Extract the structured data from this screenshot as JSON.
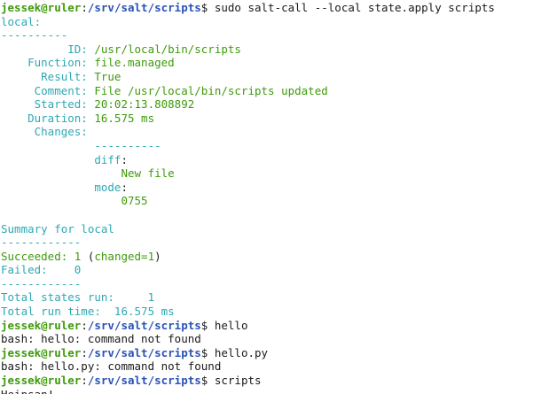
{
  "colors": {
    "background": "#ffffff",
    "text": "#1a1a1a",
    "prompt_user": "#3f9a0c",
    "prompt_path": "#2a52b8",
    "salt_cyan": "#2ea8b4",
    "salt_green": "#3f9a0c"
  },
  "lines": [
    {
      "segs": [
        [
          "user",
          "jessek@ruler"
        ],
        [
          "pl",
          ":"
        ],
        [
          "path",
          "/srv/salt/scripts"
        ],
        [
          "pl",
          "$ "
        ],
        [
          "cmd",
          "sudo salt-call --local state.apply scripts"
        ]
      ],
      "name": "prompt-line",
      "interactable": false
    },
    {
      "segs": [
        [
          "cy",
          "local:"
        ]
      ],
      "name": "minion-header"
    },
    {
      "segs": [
        [
          "cy",
          "----------"
        ]
      ],
      "name": "separator"
    },
    {
      "segs": [
        [
          "cy",
          "          ID: "
        ],
        [
          "gr",
          "/usr/local/bin/scripts"
        ]
      ],
      "name": "state-id"
    },
    {
      "segs": [
        [
          "cy",
          "    Function: "
        ],
        [
          "gr",
          "file.managed"
        ]
      ],
      "name": "state-function"
    },
    {
      "segs": [
        [
          "cy",
          "      Result: "
        ],
        [
          "gr",
          "True"
        ]
      ],
      "name": "state-result"
    },
    {
      "segs": [
        [
          "cy",
          "     Comment: "
        ],
        [
          "gr",
          "File /usr/local/bin/scripts updated"
        ]
      ],
      "name": "state-comment"
    },
    {
      "segs": [
        [
          "cy",
          "     Started: "
        ],
        [
          "gr",
          "20:02:13.808892"
        ]
      ],
      "name": "state-started"
    },
    {
      "segs": [
        [
          "cy",
          "    Duration: "
        ],
        [
          "gr",
          "16.575 ms"
        ]
      ],
      "name": "state-duration"
    },
    {
      "segs": [
        [
          "cy",
          "     Changes:"
        ]
      ],
      "name": "state-changes"
    },
    {
      "segs": [
        [
          "cy",
          "              ----------"
        ]
      ],
      "name": "changes-separator"
    },
    {
      "segs": [
        [
          "cy",
          "              diff"
        ],
        [
          "pl",
          ":"
        ]
      ],
      "name": "changes-diff-key"
    },
    {
      "segs": [
        [
          "gr",
          "                  New file"
        ]
      ],
      "name": "changes-diff-value"
    },
    {
      "segs": [
        [
          "cy",
          "              mode"
        ],
        [
          "pl",
          ":"
        ]
      ],
      "name": "changes-mode-key"
    },
    {
      "segs": [
        [
          "gr",
          "                  0755"
        ]
      ],
      "name": "changes-mode-value"
    },
    {
      "segs": [],
      "name": "blank-line"
    },
    {
      "segs": [
        [
          "cy",
          "Summary for local"
        ]
      ],
      "name": "summary-header"
    },
    {
      "segs": [
        [
          "cy",
          "------------"
        ]
      ],
      "name": "summary-separator"
    },
    {
      "segs": [
        [
          "gr",
          "Succeeded: 1 "
        ],
        [
          "pl",
          "("
        ],
        [
          "gr",
          "changed=1"
        ],
        [
          "pl",
          ")"
        ]
      ],
      "name": "summary-succeeded"
    },
    {
      "segs": [
        [
          "cy",
          "Failed:    0"
        ]
      ],
      "name": "summary-failed"
    },
    {
      "segs": [
        [
          "cy",
          "------------"
        ]
      ],
      "name": "summary-separator"
    },
    {
      "segs": [
        [
          "cy",
          "Total states run:     1"
        ]
      ],
      "name": "summary-total-states"
    },
    {
      "segs": [
        [
          "cy",
          "Total run time:  16.575 ms"
        ]
      ],
      "name": "summary-total-time"
    },
    {
      "segs": [
        [
          "user",
          "jessek@ruler"
        ],
        [
          "pl",
          ":"
        ],
        [
          "path",
          "/srv/salt/scripts"
        ],
        [
          "pl",
          "$ "
        ],
        [
          "cmd",
          "hello"
        ]
      ],
      "name": "prompt-line"
    },
    {
      "segs": [
        [
          "pl",
          "bash: hello: command not found"
        ]
      ],
      "name": "error-output"
    },
    {
      "segs": [
        [
          "user",
          "jessek@ruler"
        ],
        [
          "pl",
          ":"
        ],
        [
          "path",
          "/srv/salt/scripts"
        ],
        [
          "pl",
          "$ "
        ],
        [
          "cmd",
          "hello.py"
        ]
      ],
      "name": "prompt-line"
    },
    {
      "segs": [
        [
          "pl",
          "bash: hello.py: command not found"
        ]
      ],
      "name": "error-output"
    },
    {
      "segs": [
        [
          "user",
          "jessek@ruler"
        ],
        [
          "pl",
          ":"
        ],
        [
          "path",
          "/srv/salt/scripts"
        ],
        [
          "pl",
          "$ "
        ],
        [
          "cmd",
          "scripts"
        ]
      ],
      "name": "prompt-line"
    },
    {
      "segs": [
        [
          "pl",
          "Heipsan!"
        ]
      ],
      "name": "program-output"
    }
  ]
}
